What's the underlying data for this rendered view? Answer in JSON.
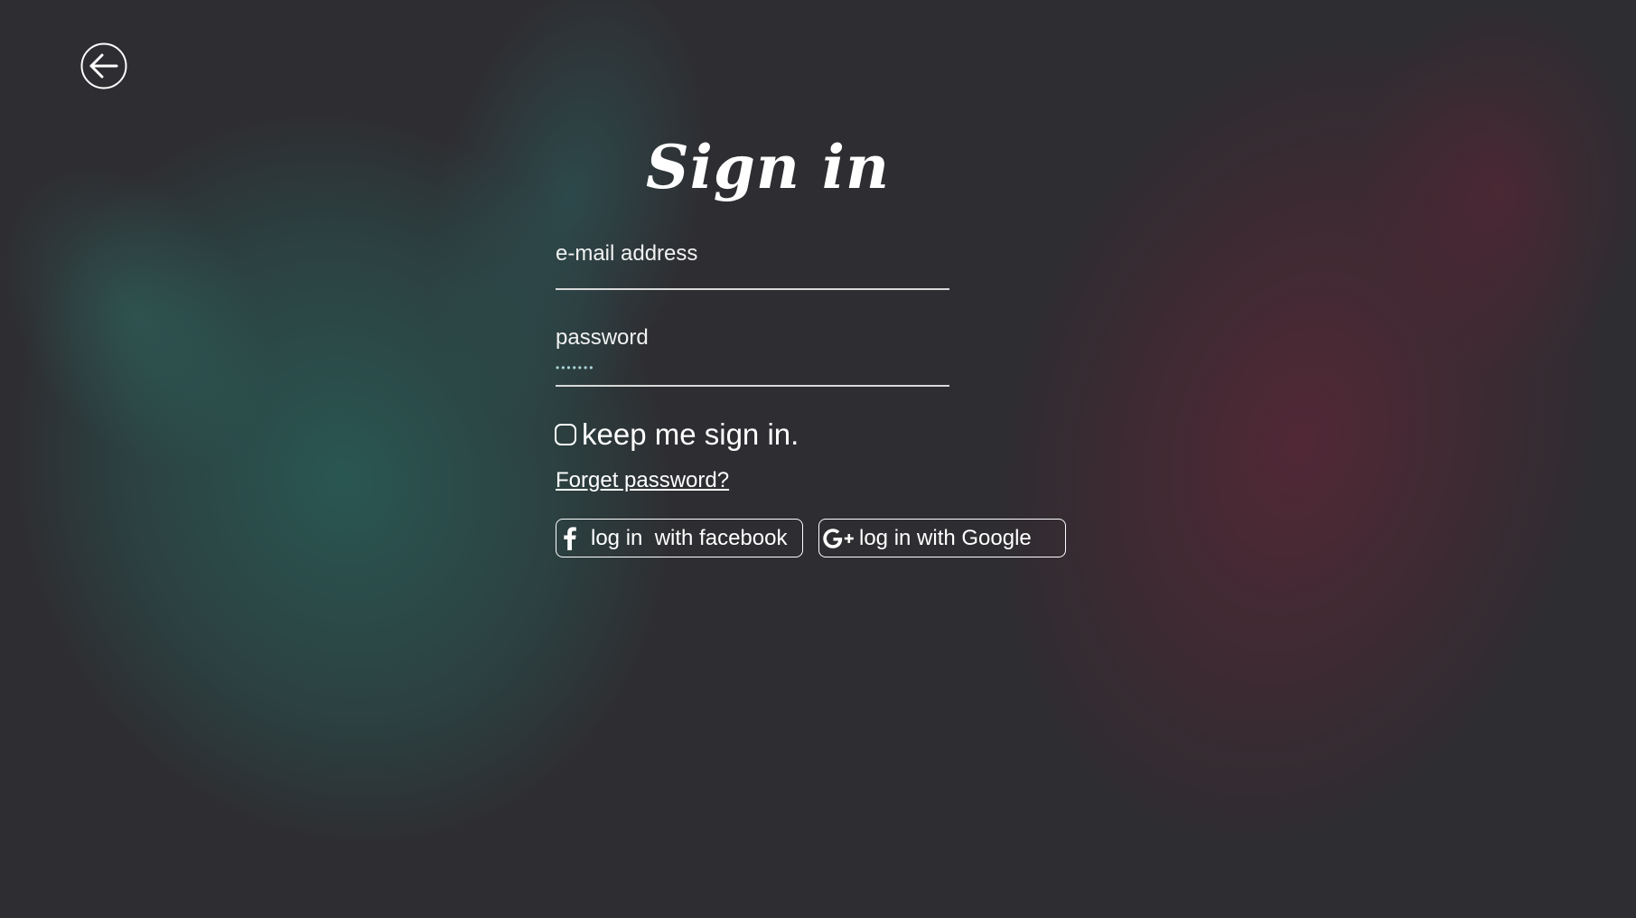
{
  "back_button": {
    "icon": "arrow-left-circle-icon"
  },
  "title": "Sign in",
  "email": {
    "label": "e-mail address",
    "value": ""
  },
  "password": {
    "label": "password",
    "value": "•••••••"
  },
  "keep_signed_in": {
    "label": "keep me sign in.",
    "checked": false
  },
  "forget_password": "Forget password?",
  "social": {
    "facebook": {
      "label": "log in  with facebook",
      "icon": "facebook-icon"
    },
    "google": {
      "label": "log in with Google",
      "icon": "google-plus-icon"
    }
  },
  "colors": {
    "background": "#2e2d31",
    "teal_smudge": "#286860",
    "red_smudge": "#602638",
    "text": "#ffffff"
  }
}
